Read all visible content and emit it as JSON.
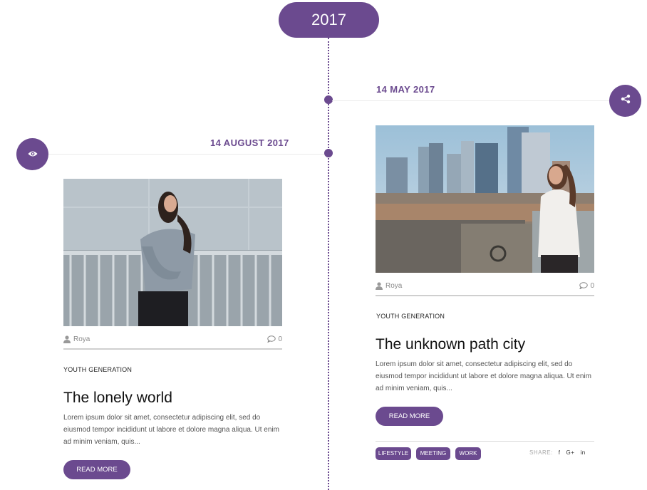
{
  "timeline": {
    "year": "2017"
  },
  "posts": [
    {
      "date": "14 MAY 2017",
      "author": "Roya",
      "comments": "0",
      "category": "YOUTH GENERATION",
      "title": "The unknown path city",
      "excerpt": "Lorem ipsum dolor sit amet, consectetur adipiscing elit, sed do eiusmod tempor incididunt ut labore et dolore magna aliqua. Ut enim ad minim veniam, quis...",
      "read_more": "READ MORE",
      "tags": [
        "LIFESTYLE",
        "MEETING",
        "WORK"
      ],
      "share_label": "SHARE:",
      "share_links": [
        "f",
        "G+",
        "in"
      ]
    },
    {
      "date": "14 AUGUST 2017",
      "author": "Roya",
      "comments": "0",
      "category": "YOUTH GENERATION",
      "title": "The lonely world",
      "excerpt": "Lorem ipsum dolor sit amet, consectetur adipiscing elit, sed do eiusmod tempor incididunt ut labore et dolore magna aliqua. Ut enim ad minim veniam, quis...",
      "read_more": "READ MORE"
    }
  ],
  "icons": {
    "share_button": "share-icon",
    "view_button": "eye-icon",
    "author": "user-icon",
    "comments": "comment-icon"
  },
  "colors": {
    "accent": "#6b4a8f",
    "text": "#111111",
    "muted": "#555555"
  }
}
